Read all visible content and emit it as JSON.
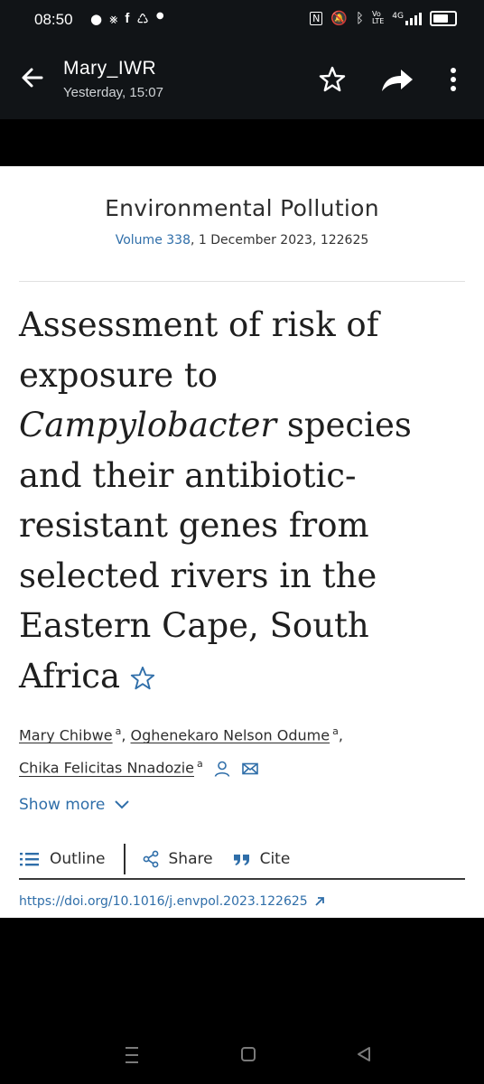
{
  "status_bar": {
    "time": "08:50",
    "left_icons": [
      "chat-bubble-icon",
      "bike-icon",
      "facebook-icon",
      "recycle-icon",
      "dot-icon"
    ],
    "right_icons": [
      "nfc-icon",
      "mute-icon",
      "bluetooth-icon",
      "volte-icon",
      "4g-signal-icon",
      "battery-icon"
    ],
    "volte_label": "Vo\nLTE",
    "network_label": "4G"
  },
  "app_bar": {
    "sender": "Mary_IWR",
    "timestamp": "Yesterday, 15:07",
    "actions": [
      "back-arrow-icon",
      "star-icon",
      "forward-icon",
      "more-vertical-icon"
    ]
  },
  "article": {
    "journal": "Environmental Pollution",
    "volume_link": "Volume 338",
    "volume_rest": ", 1 December 2023, 122625",
    "title_part1": "Assessment of risk of exposure to",
    "title_italic": "Campylobacter",
    "title_part2": "species and their antibiotic-resistant genes from selected rivers in the Eastern Cape, South Africa",
    "authors": [
      {
        "name": "Mary Chibwe",
        "aff": "a",
        "sep": ","
      },
      {
        "name": "Oghenekaro Nelson Odume",
        "aff": "a",
        "sep": ","
      },
      {
        "name": "Chika Felicitas Nnadozie",
        "aff": "a",
        "sep": ""
      }
    ],
    "show_more": "Show more",
    "toolbar": {
      "outline": "Outline",
      "share": "Share",
      "cite": "Cite"
    },
    "doi": "https://doi.org/10.1016/j.envpol.2023.122625"
  },
  "colors": {
    "link": "#2f6ea9",
    "app_bar": "#111417",
    "page": "#ffffff"
  }
}
